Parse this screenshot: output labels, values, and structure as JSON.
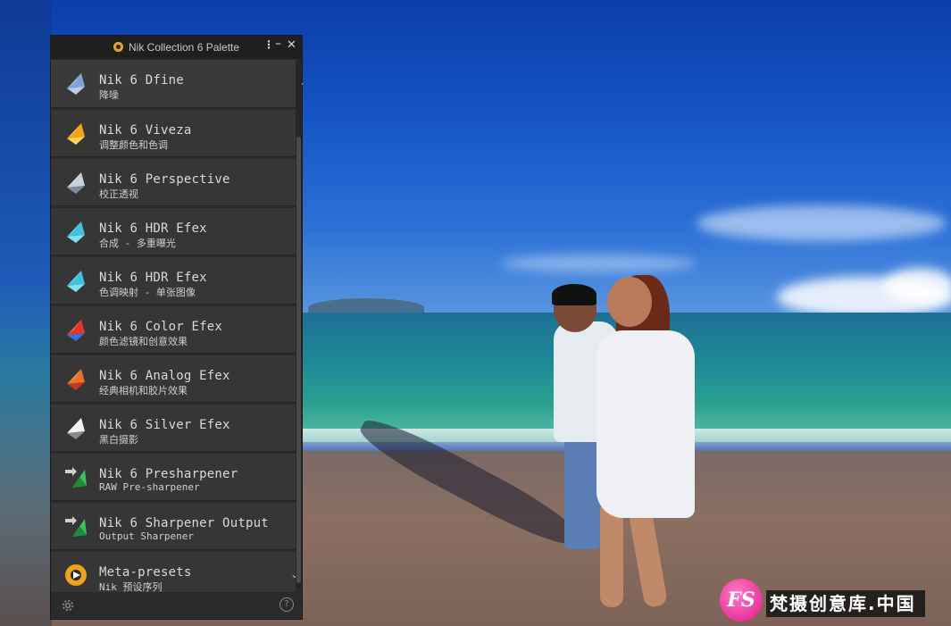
{
  "window": {
    "title": "Nik Collection 6 Palette",
    "menu_icon": "kebab-icon",
    "minimize_icon": "minimize-icon",
    "close_icon": "close-icon"
  },
  "items": [
    {
      "name": "Nik 6 Dfine",
      "sub": "降噪",
      "icon": "dfine-icon",
      "colors": [
        "#7fa3d6",
        "#b8cdee"
      ],
      "expandable": true
    },
    {
      "name": "Nik 6 Viveza",
      "sub": "调整颜色和色调",
      "icon": "viveza-icon",
      "colors": [
        "#f3a21b",
        "#ffd25a"
      ]
    },
    {
      "name": "Nik 6 Perspective",
      "sub": "校正透视",
      "icon": "perspective-icon",
      "colors": [
        "#c8d0dc",
        "#7e8a9c"
      ]
    },
    {
      "name": "Nik 6 HDR Efex",
      "sub": "合成 - 多重曝光",
      "icon": "hdr-efex-icon",
      "colors": [
        "#3cc1e0",
        "#7fe1f3"
      ]
    },
    {
      "name": "Nik 6 HDR Efex",
      "sub": "色调映射 - 单张图像",
      "icon": "hdr-efex-icon",
      "colors": [
        "#3cc1e0",
        "#7fe1f3"
      ]
    },
    {
      "name": "Nik 6 Color Efex",
      "sub": "颜色滤镜和创意效果",
      "icon": "color-efex-icon",
      "colors": [
        "#e2362a",
        "#3b6fd6"
      ]
    },
    {
      "name": "Nik 6 Analog Efex",
      "sub": "经典相机和胶片效果",
      "icon": "analog-efex-icon",
      "colors": [
        "#e8732a",
        "#c2352a"
      ]
    },
    {
      "name": "Nik 6 Silver Efex",
      "sub": "黑白摄影",
      "icon": "silver-efex-icon",
      "colors": [
        "#f2f2f2",
        "#8a8a8a"
      ]
    },
    {
      "name": "Nik 6 Presharpener",
      "sub": "RAW Pre-sharpener",
      "icon": "presharpener-icon",
      "colors": [
        "#3cc25a",
        "#1e8a3a"
      ]
    },
    {
      "name": "Nik 6 Sharpener Output",
      "sub": "Output Sharpener",
      "icon": "sharpener-output-icon",
      "colors": [
        "#3cc25a",
        "#1e8a3a"
      ]
    },
    {
      "name": "Meta-presets",
      "sub": "Nik 预设序列",
      "icon": "meta-presets-icon",
      "colors": [
        "#f0a21a",
        "#ffffff"
      ],
      "expandable": true
    }
  ],
  "footer": {
    "settings_icon": "gear-icon",
    "help_label": "?"
  },
  "watermark": {
    "badge": "FS",
    "text": "梵摄创意库.中国"
  }
}
